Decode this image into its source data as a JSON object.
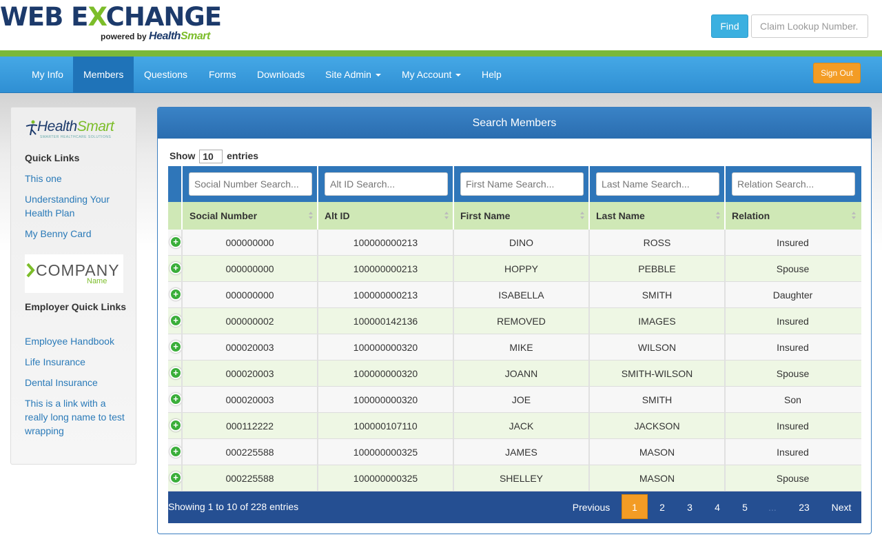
{
  "header": {
    "logo_web": "WEB E",
    "logo_x": "X",
    "logo_change": "CHANGE",
    "powered_by": "powered by",
    "powered_health": "Health",
    "powered_smart": "Smart",
    "find_label": "Find",
    "claim_placeholder": "Claim Lookup Number."
  },
  "nav": {
    "items": [
      "My Info",
      "Members",
      "Questions",
      "Forms",
      "Downloads",
      "Site Admin",
      "My Account",
      "Help"
    ],
    "active": "Members",
    "signout": "Sign Out"
  },
  "sidebar": {
    "logo_health": "Health",
    "logo_smart": "Smart",
    "logo_tagline": "SMARTER HEALTHCARE SOLUTIONS",
    "quick_links_title": "Quick Links",
    "quick_links": [
      "This one",
      "Understanding Your Health Plan",
      "My Benny Card"
    ],
    "company_logo_text": "COMPANY",
    "company_logo_name": "Name",
    "employer_title": "Employer Quick Links",
    "employer_links": [
      "Employee Handbook",
      "Life Insurance",
      "Dental Insurance",
      "This is a link with a really long name to test wrapping"
    ]
  },
  "panel": {
    "title": "Search Members",
    "show_label": "Show",
    "show_value": "10",
    "entries_label": "entries"
  },
  "table": {
    "search_placeholders": [
      "Social Number Search...",
      "Alt ID Search...",
      "First Name Search...",
      "Last Name Search...",
      "Relation Search..."
    ],
    "headers": [
      "Social Number",
      "Alt ID",
      "First Name",
      "Last Name",
      "Relation"
    ],
    "rows": [
      [
        "000000000",
        "100000000213",
        "DINO",
        "ROSS",
        "Insured"
      ],
      [
        "000000000",
        "100000000213",
        "HOPPY",
        "PEBBLE",
        "Spouse"
      ],
      [
        "000000000",
        "100000000213",
        "ISABELLA",
        "SMITH",
        "Daughter"
      ],
      [
        "000000002",
        "100000142136",
        "REMOVED",
        "IMAGES",
        "Insured"
      ],
      [
        "000020003",
        "100000000320",
        "MIKE",
        "WILSON",
        "Insured"
      ],
      [
        "000020003",
        "100000000320",
        "JOANN",
        "SMITH-WILSON",
        "Spouse"
      ],
      [
        "000020003",
        "100000000320",
        "JOE",
        "SMITH",
        "Son"
      ],
      [
        "000112222",
        "100000107110",
        "JACK",
        "JACKSON",
        "Insured"
      ],
      [
        "000225588",
        "100000000325",
        "JAMES",
        "MASON",
        "Insured"
      ],
      [
        "000225588",
        "100000000325",
        "SHELLEY",
        "MASON",
        "Spouse"
      ]
    ]
  },
  "pagination": {
    "info": "Showing 1 to 10 of 228 entries",
    "previous": "Previous",
    "pages": [
      "1",
      "2",
      "3",
      "4",
      "5",
      "...",
      "23"
    ],
    "current": "1",
    "next": "Next"
  }
}
